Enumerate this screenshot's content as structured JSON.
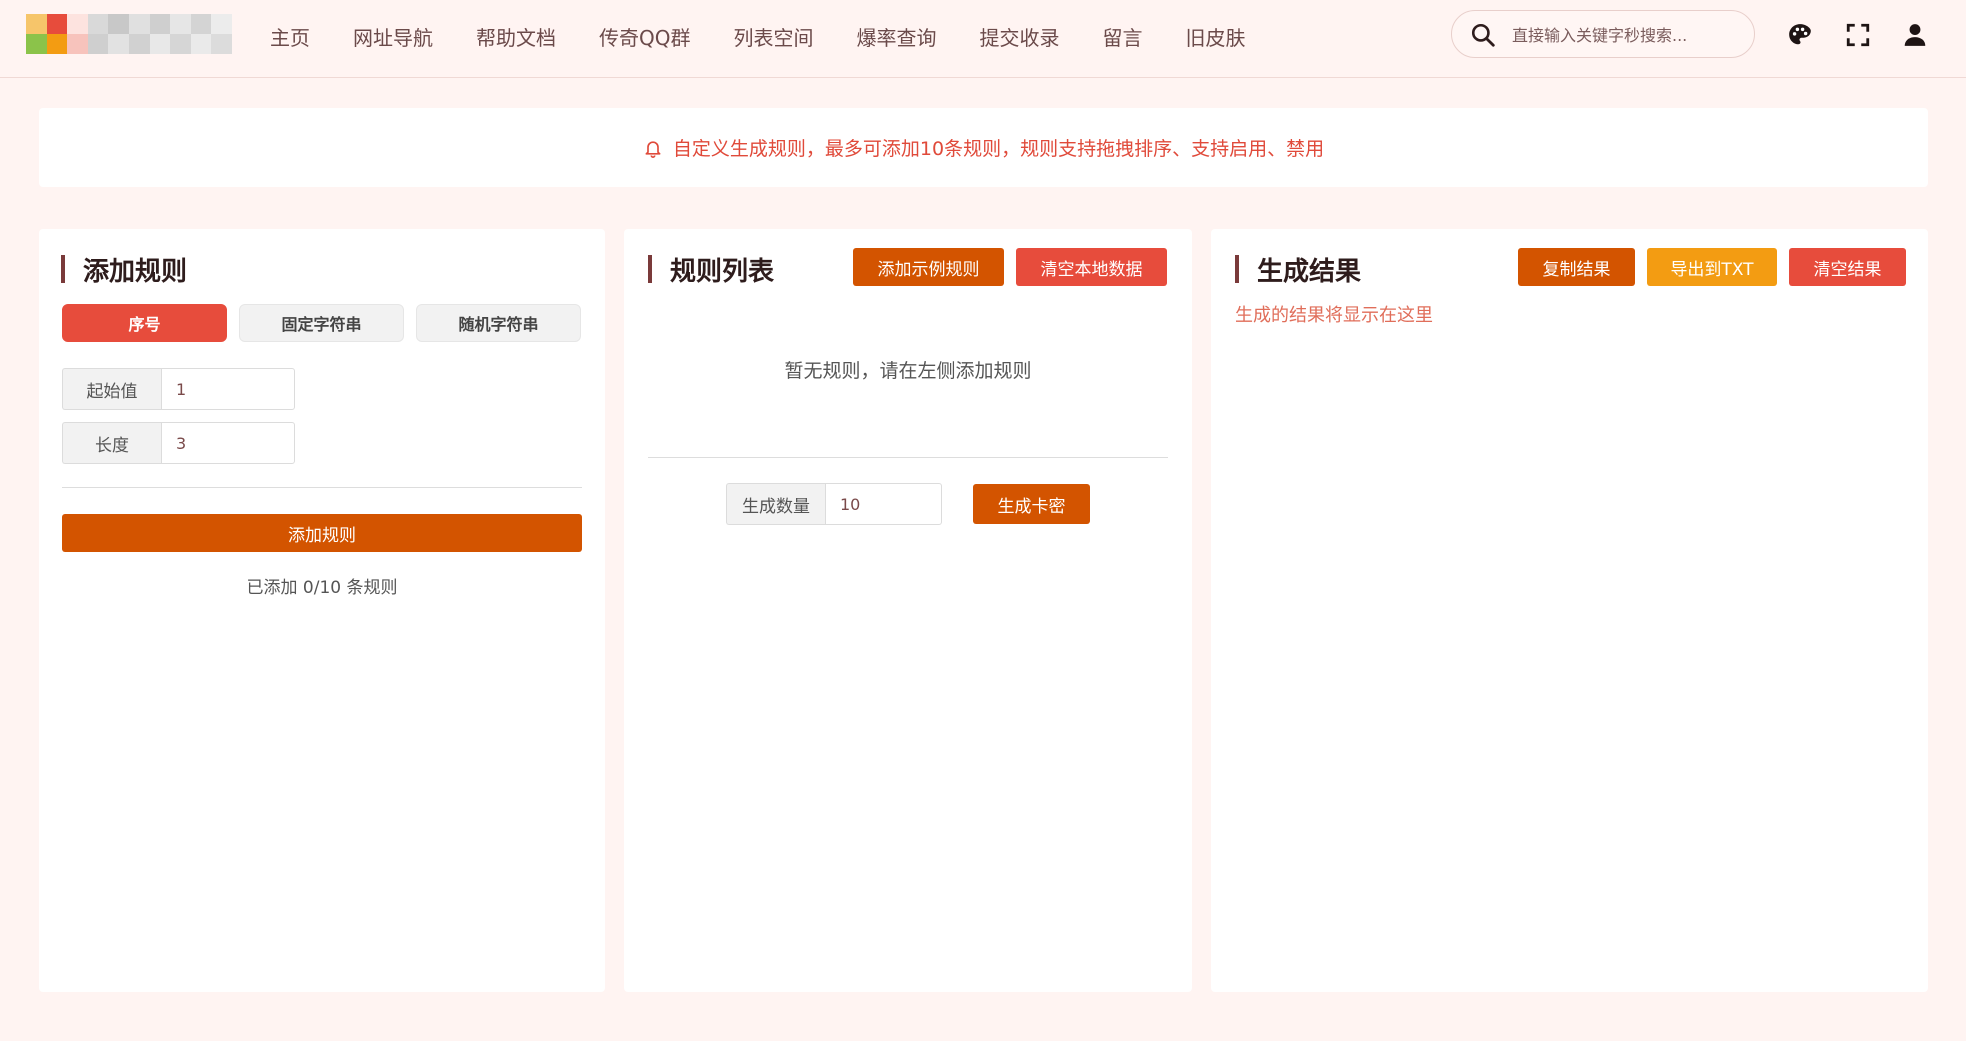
{
  "nav": {
    "items": [
      "主页",
      "网址导航",
      "帮助文档",
      "传奇QQ群",
      "列表空间",
      "爆率查询",
      "提交收录",
      "留言",
      "旧皮肤"
    ]
  },
  "search": {
    "placeholder": "直接输入关键字秒搜索..."
  },
  "notice": {
    "text": "自定义生成规则，最多可添加10条规则，规则支持拖拽排序、支持启用、禁用"
  },
  "add_rule": {
    "title": "添加规则",
    "tabs": [
      "序号",
      "固定字符串",
      "随机字符串"
    ],
    "start_label": "起始值",
    "start_value": "1",
    "length_label": "长度",
    "length_value": "3",
    "add_button": "添加规则",
    "count_text": "已添加 0/10 条规则"
  },
  "rule_list": {
    "title": "规则列表",
    "sample_button": "添加示例规则",
    "clear_button": "清空本地数据",
    "empty_text": "暂无规则，请在左侧添加规则",
    "count_label": "生成数量",
    "count_value": "10",
    "generate_button": "生成卡密"
  },
  "result": {
    "title": "生成结果",
    "copy_button": "复制结果",
    "export_button": "导出到TXT",
    "clear_button": "清空结果",
    "placeholder": "生成的结果将显示在这里"
  },
  "colors": {
    "accent_dark": "#d35400",
    "accent_red": "#e74c3c",
    "accent_orange": "#f39c12",
    "background": "#fff4f2"
  }
}
